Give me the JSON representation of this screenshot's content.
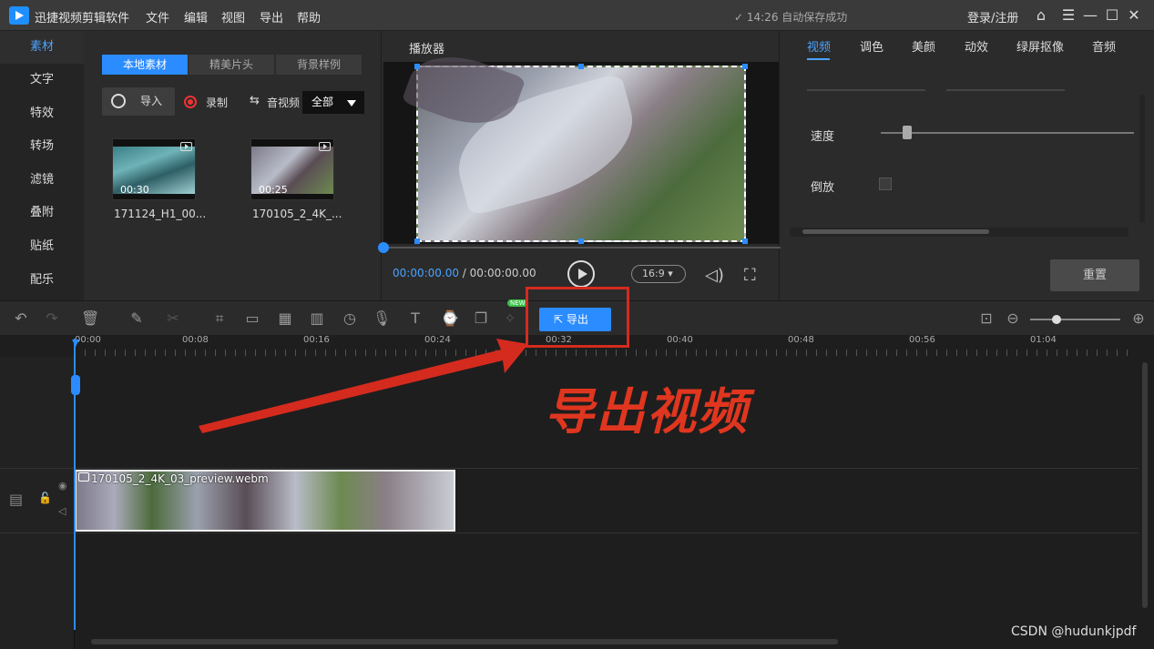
{
  "app": {
    "name": "迅捷视频剪辑软件",
    "menus": [
      "文件",
      "编辑",
      "视图",
      "导出",
      "帮助"
    ],
    "autosave": "14:26 自动保存成功",
    "login": "登录/注册"
  },
  "leftnav": [
    "素材",
    "文字",
    "特效",
    "转场",
    "滤镜",
    "叠附",
    "贴纸",
    "配乐"
  ],
  "media": {
    "tabs": [
      "本地素材",
      "精美片头",
      "背景样例"
    ],
    "import": "导入",
    "record": "录制",
    "audio": "音视频",
    "filter": "全部",
    "items": [
      {
        "duration": "00:30",
        "name": "171124_H1_00..."
      },
      {
        "duration": "00:25",
        "name": "170105_2_4K_..."
      }
    ]
  },
  "player": {
    "title": "播放器",
    "current": "00:00:00.00",
    "sep": " / ",
    "total": "00:00:00.00",
    "ratio": "16:9"
  },
  "props": {
    "tabs": [
      "视频",
      "调色",
      "美颜",
      "动效",
      "绿屏抠像",
      "音频"
    ],
    "speed": "速度",
    "reverse": "倒放",
    "reset": "重置",
    "speed_value": 0.1
  },
  "toolbar": {
    "export": "导出",
    "new": "NEW"
  },
  "timeline": {
    "ticks": [
      "00:00",
      "00:08",
      "00:16",
      "00:24",
      "00:32",
      "00:40",
      "00:48",
      "00:56",
      "01:04"
    ],
    "clip": "170105_2_4K_03_preview.webm"
  },
  "annotation": {
    "text": "导出视频"
  },
  "watermark": "CSDN @hudunkjpdf",
  "colors": {
    "accent": "#2a8cff",
    "annotation": "#e0361f"
  }
}
